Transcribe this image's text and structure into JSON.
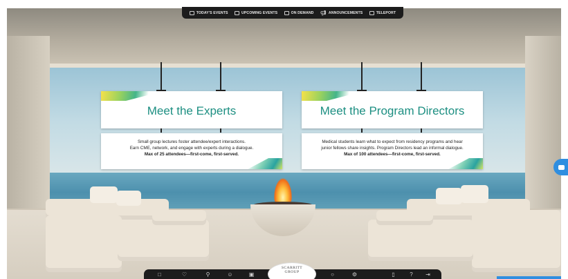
{
  "top_nav": {
    "items": [
      {
        "label": "TODAY'S EVENTS",
        "icon": "calendar-icon"
      },
      {
        "label": "UPCOMING EVENTS",
        "icon": "calendar-icon"
      },
      {
        "label": "ON DEMAND",
        "icon": "video-icon"
      },
      {
        "label": "ANNOUNCEMENTS",
        "icon": "megaphone-icon"
      },
      {
        "label": "TELEPORT",
        "icon": "teleport-icon"
      }
    ]
  },
  "signs": {
    "experts": {
      "title": "Meet the Experts",
      "line1": "Small group lectures foster attendee/expert interactions.",
      "line2": "Earn CME, network, and engage with experts during a dialogue.",
      "line3": "Max of 25 attendees—first-come, first-served."
    },
    "directors": {
      "title": "Meet the Program Directors",
      "line1": "Medical students learn what to expect from residency programs and hear",
      "line2": "junior fellows share insights. Program Directors lead an informal dialogue.",
      "line3": "Max of 100 attendees—first-come, first-served."
    }
  },
  "bottom_bar": {
    "logo_line1": "SCARRITT",
    "logo_line2": "GROUP",
    "icons": [
      "folder-icon",
      "heart-icon",
      "search-icon",
      "people-icon",
      "briefcase-icon",
      "chat-icon",
      "settings-icon",
      "document-icon",
      "help-icon",
      "exit-icon"
    ]
  },
  "colors": {
    "accent": "#1d8f82",
    "nav_bg": "#1c1c1c",
    "chat_button": "#2f8ee0"
  }
}
